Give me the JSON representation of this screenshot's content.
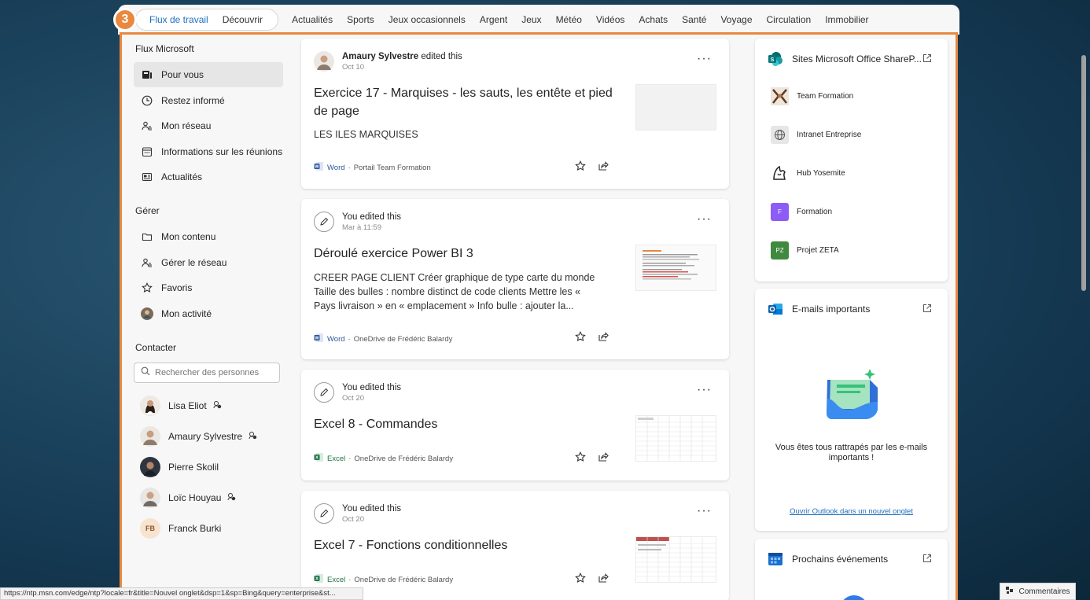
{
  "step_badge": "3",
  "nav": {
    "pill_tabs": [
      "Flux de travail",
      "Découvrir"
    ],
    "links": [
      "Actualités",
      "Sports",
      "Jeux occasionnels",
      "Argent",
      "Jeux",
      "Météo",
      "Vidéos",
      "Achats",
      "Santé",
      "Voyage",
      "Circulation",
      "Immobilier"
    ]
  },
  "sidebar": {
    "section1_title": "Flux Microsoft",
    "feed_items": [
      "Pour vous",
      "Restez informé",
      "Mon réseau",
      "Informations sur les réunions",
      "Actualités"
    ],
    "section2_title": "Gérer",
    "manage_items": [
      "Mon contenu",
      "Gérer le réseau",
      "Favoris",
      "Mon activité"
    ],
    "section3_title": "Contacter",
    "search_placeholder": "Rechercher des personnes",
    "people": [
      "Lisa Eliot",
      "Amaury Sylvestre",
      "Pierre Skolil",
      "Loïc Houyau",
      "Franck Burki"
    ],
    "franck_initials": "FB"
  },
  "cards": [
    {
      "editor_name": "Amaury Sylvestre",
      "editor_action": " edited this",
      "date": "Oct 10",
      "title": "Exercice 17 - Marquises - les sauts, les entête et pied de page",
      "desc": "LES ILES MARQUISES",
      "app": "Word",
      "location": "Portail Team Formation"
    },
    {
      "editor_name": "",
      "editor_action": "You edited this",
      "date": "Mar à 11:59",
      "title": "Déroulé exercice Power BI 3",
      "desc": "CREER PAGE CLIENT Créer graphique de type carte du monde Taille des bulles : nombre distinct de code clients Mettre les « Pays livraison » en « emplacement » Info bulle : ajouter la...",
      "app": "Word",
      "location": "OneDrive de Frédéric Balardy"
    },
    {
      "editor_name": "",
      "editor_action": "You edited this",
      "date": "Oct 20",
      "title": "Excel 8 - Commandes",
      "desc": "",
      "app": "Excel",
      "location": "OneDrive de Frédéric Balardy"
    },
    {
      "editor_name": "",
      "editor_action": "You edited this",
      "date": "Oct 20",
      "title": "Excel 7 - Fonctions conditionnelles",
      "desc": "",
      "app": "Excel",
      "location": "OneDrive de Frédéric Balardy"
    }
  ],
  "sites_panel": {
    "title": "Sites Microsoft Office ShareP...",
    "sites": [
      "Team Formation",
      "Intranet Entreprise",
      "Hub Yosemite",
      "Formation",
      "Projet ZETA"
    ],
    "formation_letter": "F",
    "zeta_letters": "PZ"
  },
  "mail_panel": {
    "title": "E-mails importants",
    "message": "Vous êtes tous rattrapés par les e-mails importants !",
    "link": "Ouvrir Outlook dans un nouvel onglet"
  },
  "events_panel": {
    "title": "Prochains événements"
  },
  "status_url": "https://ntp.msn.com/edge/ntp?locale=fr&title=Nouvel onglet&dsp=1&sp=Bing&query=enterprise&st...",
  "feedback_label": "Commentaires",
  "colors": {
    "accent": "#e9883e",
    "active_tab": "#1f6fc0",
    "word": "#2b579a",
    "excel": "#217346",
    "link": "#1f6fc0"
  }
}
